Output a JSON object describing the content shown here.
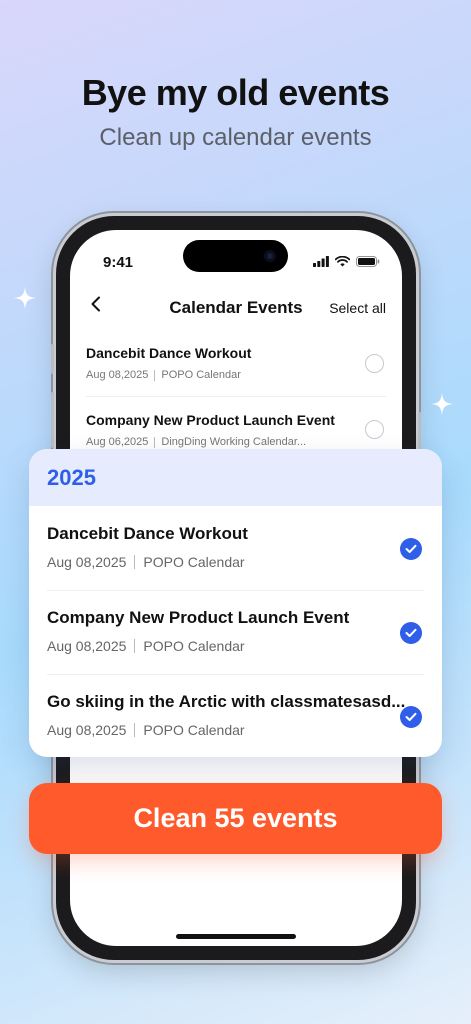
{
  "headline": "Bye my old events",
  "subheadline": "Clean up calendar events",
  "phone": {
    "status_time": "9:41",
    "nav_title": "Calendar Events",
    "select_all_label": "Select all",
    "events": [
      {
        "title": "Dancebit Dance Workout",
        "date": "Aug 08,2025",
        "calendar": "POPO Calendar",
        "selected": false
      },
      {
        "title": "Company New Product Launch Event",
        "date": "Aug 06,2025",
        "calendar": "DingDing Working Calendar...",
        "selected": false
      }
    ]
  },
  "card": {
    "year": "2025",
    "events": [
      {
        "title": "Dancebit Dance Workout",
        "date": "Aug 08,2025",
        "calendar": "POPO Calendar",
        "selected": true
      },
      {
        "title": "Company New Product Launch Event",
        "date": "Aug 08,2025",
        "calendar": "POPO Calendar",
        "selected": true
      },
      {
        "title": "Go skiing in the Arctic with classmatesasd...",
        "date": "Aug 08,2025",
        "calendar": "POPO Calendar",
        "selected": true
      }
    ]
  },
  "clean_button_label": "Clean 55 events",
  "colors": {
    "accent_blue": "#2f5fe8",
    "cta_orange": "#ff5a2c",
    "card_header_bg": "#e6ecfd"
  }
}
